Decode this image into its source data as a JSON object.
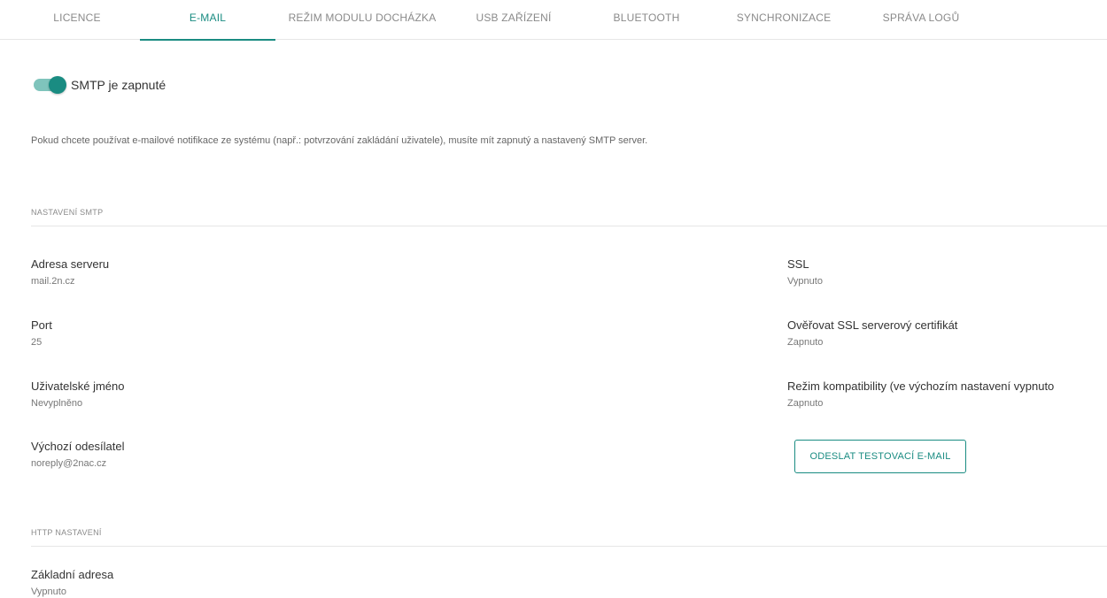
{
  "tabs": [
    {
      "label": "LICENCE"
    },
    {
      "label": "E-MAIL"
    },
    {
      "label": "REŽIM MODULU DOCHÁZKA"
    },
    {
      "label": "USB ZAŘÍZENÍ"
    },
    {
      "label": "BLUETOOTH"
    },
    {
      "label": "SYNCHRONIZACE"
    },
    {
      "label": "SPRÁVA LOGŮ"
    }
  ],
  "active_tab": "E-MAIL",
  "smtp_toggle": {
    "label": "SMTP je zapnuté",
    "on": true
  },
  "info_text": "Pokud chcete používat e-mailové notifikace ze systému (např.: potvrzování zakládání uživatele), musíte mít zapnutý a nastavený SMTP server.",
  "smtp_section": {
    "title": "NASTAVENÍ SMTP",
    "fields_left": [
      {
        "label": "Adresa serveru",
        "value": "mail.2n.cz"
      },
      {
        "label": "Port",
        "value": "25"
      },
      {
        "label": "Uživatelské jméno",
        "value": "Nevyplněno"
      },
      {
        "label": "Výchozí odesílatel",
        "value": "noreply@2nac.cz"
      }
    ],
    "fields_right": [
      {
        "label": "SSL",
        "value": "Vypnuto"
      },
      {
        "label": "Ověřovat SSL serverový certifikát",
        "value": "Zapnuto"
      },
      {
        "label": "Režim kompatibility (ve výchozím nastavení vypnuto",
        "value": "Zapnuto"
      }
    ],
    "test_button": "ODESLAT TESTOVACÍ E-MAIL"
  },
  "http_section": {
    "title": "HTTP NASTAVENÍ",
    "fields": [
      {
        "label": "Základní adresa",
        "value": "Vypnuto"
      }
    ]
  },
  "colors": {
    "accent": "#1a8c82",
    "toggle_track": "#7fc4bc"
  }
}
